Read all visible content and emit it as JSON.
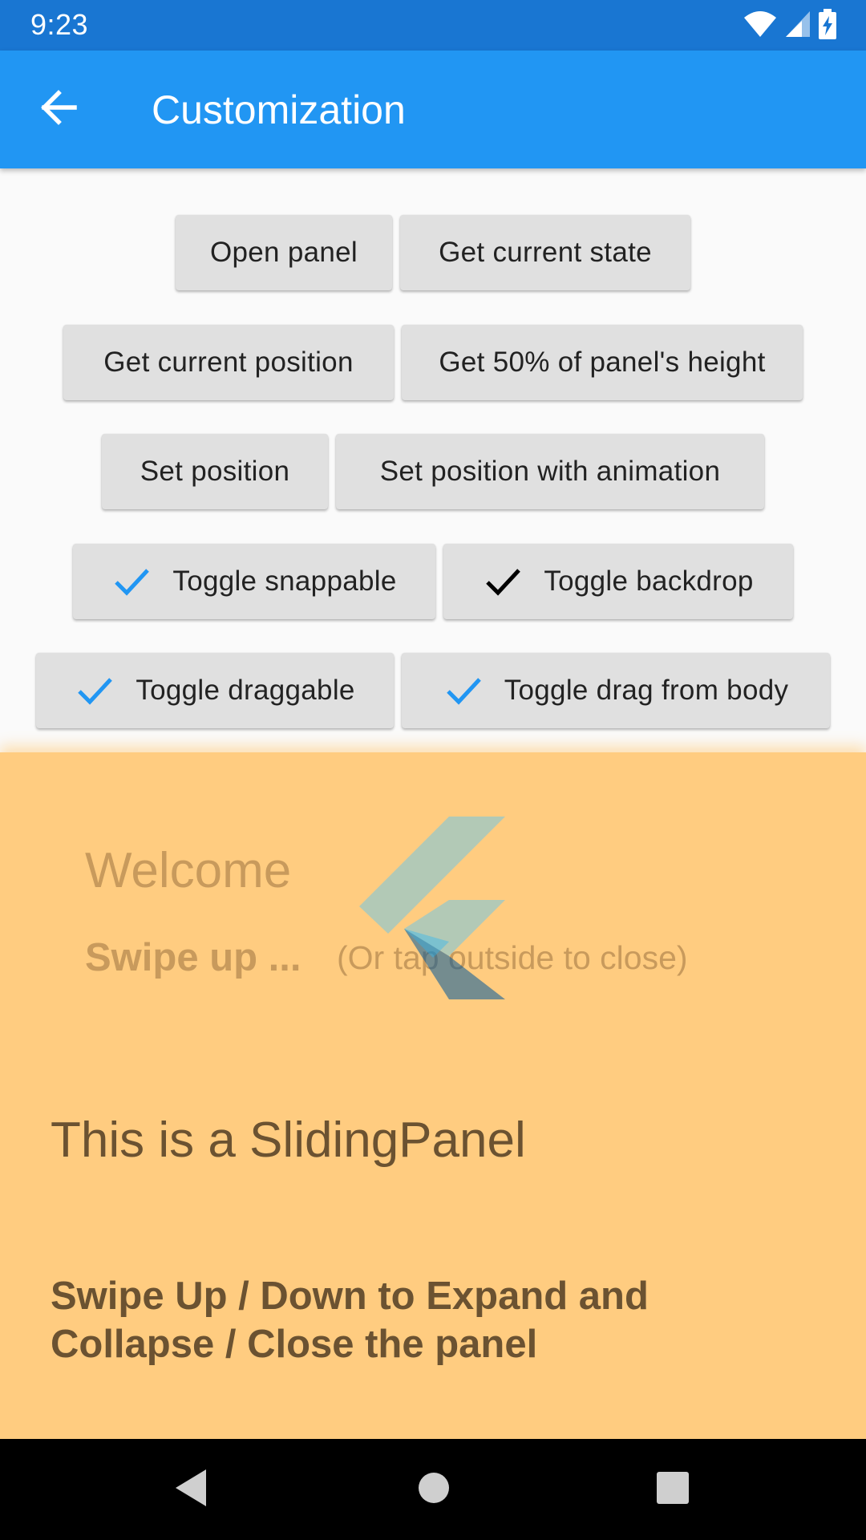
{
  "status_bar": {
    "time": "9:23",
    "icons": [
      "wifi-icon",
      "signal-icon",
      "battery-charging-icon"
    ]
  },
  "app_bar": {
    "back_icon": "arrow-back-icon",
    "title": "Customization",
    "color": "#2196f3"
  },
  "buttons": {
    "open_panel": "Open panel",
    "get_current_state": "Get current state",
    "get_current_position": "Get current position",
    "get_50_height": "Get 50% of panel's height",
    "set_position": "Set position",
    "set_position_animation": "Set position with animation",
    "toggle_snappable": "Toggle snappable",
    "toggle_backdrop": "Toggle backdrop",
    "toggle_draggable": "Toggle draggable",
    "toggle_drag_from_body": "Toggle drag from body"
  },
  "toggles": {
    "snappable_checked": true,
    "backdrop_checked": true,
    "draggable_checked": true,
    "drag_from_body_checked": true,
    "check_color_blue": "#2196f3",
    "check_color_black": "#000000"
  },
  "panel": {
    "background": "#ffcc80",
    "welcome": "Welcome",
    "swipe_up": "Swipe up ...",
    "tap_outside": "(Or tap outside to close)",
    "logo": "flutter-logo-icon",
    "title": "This is a SlidingPanel",
    "description": "Swipe Up / Down to Expand and Collapse / Close the panel"
  },
  "nav_bar": {
    "back": "nav-back-icon",
    "home": "nav-home-icon",
    "recents": "nav-recents-icon"
  }
}
